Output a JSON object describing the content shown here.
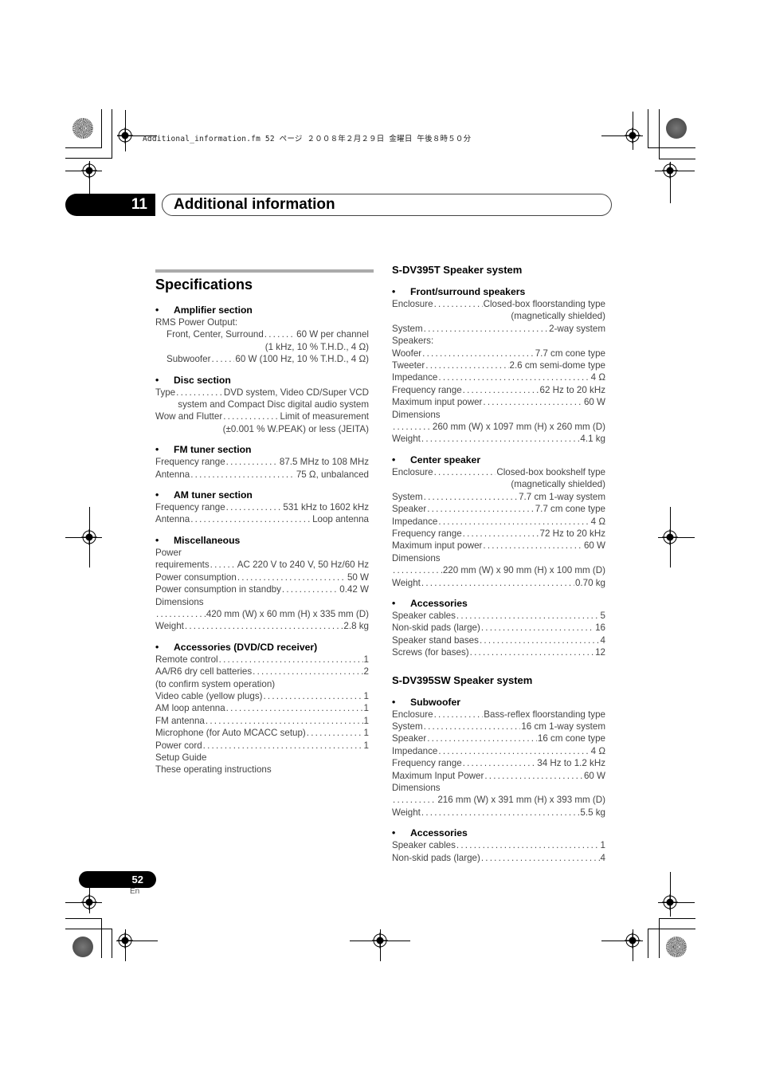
{
  "file_header": "Additional_information.fm  52 ページ  ２００８年２月２９日  金曜日  午後８時５０分",
  "chapter": {
    "number": "11",
    "title": "Additional information"
  },
  "page_title": "Specifications",
  "left_sections": [
    {
      "heading": "Amplifier section",
      "lines": [
        {
          "type": "plain",
          "text": "RMS Power Output:"
        },
        {
          "type": "row",
          "indent": true,
          "label": "Front, Center, Surround",
          "value": "60 W per channel"
        },
        {
          "type": "right",
          "text": "(1 kHz, 10 % T.H.D., 4 Ω)"
        },
        {
          "type": "row",
          "indent": true,
          "label": "Subwoofer",
          "value": "60 W (100 Hz, 10 % T.H.D., 4 Ω)"
        }
      ]
    },
    {
      "heading": "Disc section",
      "lines": [
        {
          "type": "row",
          "label": "Type",
          "value": "DVD system, Video CD/Super VCD"
        },
        {
          "type": "right",
          "text": "system and Compact Disc digital audio system"
        },
        {
          "type": "row",
          "label": "Wow and Flutter",
          "value": "Limit of measurement"
        },
        {
          "type": "right",
          "text": "(±0.001 % W.PEAK) or less (JEITA)"
        }
      ]
    },
    {
      "heading": "FM tuner section",
      "lines": [
        {
          "type": "row",
          "label": "Frequency range",
          "value": "87.5 MHz to 108 MHz"
        },
        {
          "type": "row",
          "label": "Antenna",
          "value": "75 Ω, unbalanced"
        }
      ]
    },
    {
      "heading": "AM tuner section",
      "lines": [
        {
          "type": "row",
          "label": "Frequency range",
          "value": "531 kHz to 1602 kHz"
        },
        {
          "type": "row",
          "label": "Antenna",
          "value": "Loop antenna"
        }
      ]
    },
    {
      "heading": "Miscellaneous",
      "lines": [
        {
          "type": "plain",
          "text": "Power"
        },
        {
          "type": "row",
          "label": "requirements",
          "value": "AC 220 V to 240 V, 50 Hz/60 Hz"
        },
        {
          "type": "row",
          "label": "Power consumption",
          "value": "50 W"
        },
        {
          "type": "row",
          "label": "Power consumption in standby",
          "value": "0.42 W"
        },
        {
          "type": "plain",
          "text": "Dimensions"
        },
        {
          "type": "row",
          "label": "",
          "value": "420 mm (W) x 60 mm (H) x 335 mm (D)"
        },
        {
          "type": "row",
          "label": "Weight",
          "value": "2.8 kg"
        }
      ]
    },
    {
      "heading": "Accessories (DVD/CD receiver)",
      "lines": [
        {
          "type": "row",
          "label": "Remote control",
          "value": "1"
        },
        {
          "type": "row",
          "label": "AA/R6 dry cell batteries",
          "value": "2"
        },
        {
          "type": "plain",
          "text": "(to confirm system operation)"
        },
        {
          "type": "row",
          "label": "Video cable (yellow plugs)",
          "value": "1"
        },
        {
          "type": "row",
          "label": "AM loop antenna",
          "value": "1"
        },
        {
          "type": "row",
          "label": "FM antenna",
          "value": "1"
        },
        {
          "type": "row",
          "label": "Microphone (for Auto MCACC setup)",
          "value": "1"
        },
        {
          "type": "row",
          "label": "Power cord",
          "value": "1"
        },
        {
          "type": "plain",
          "text": "Setup Guide"
        },
        {
          "type": "plain",
          "text": "These operating instructions"
        }
      ]
    }
  ],
  "right_systems": [
    {
      "title": "S-DV395T Speaker system",
      "sections": [
        {
          "heading": "Front/surround speakers",
          "lines": [
            {
              "type": "row",
              "label": "Enclosure",
              "value": "Closed-box floorstanding type"
            },
            {
              "type": "right",
              "text": "(magnetically shielded)"
            },
            {
              "type": "row",
              "label": "System",
              "value": "2-way system"
            },
            {
              "type": "plain",
              "text": "Speakers:"
            },
            {
              "type": "row",
              "label": "Woofer",
              "value": "7.7 cm cone type"
            },
            {
              "type": "row",
              "label": "Tweeter",
              "value": "2.6 cm semi-dome type"
            },
            {
              "type": "row",
              "label": "Impedance",
              "value": "4 Ω"
            },
            {
              "type": "row",
              "label": "Frequency range",
              "value": "62 Hz to 20 kHz"
            },
            {
              "type": "row",
              "label": "Maximum input power",
              "value": "60 W"
            },
            {
              "type": "plain",
              "text": "Dimensions"
            },
            {
              "type": "row",
              "label": "",
              "value": "260 mm (W) x 1097 mm (H) x 260 mm (D)"
            },
            {
              "type": "row",
              "label": "Weight",
              "value": "4.1 kg"
            }
          ]
        },
        {
          "heading": "Center speaker",
          "lines": [
            {
              "type": "row",
              "label": "Enclosure",
              "value": "Closed-box bookshelf type"
            },
            {
              "type": "right",
              "text": "(magnetically shielded)"
            },
            {
              "type": "row",
              "label": "System",
              "value": "7.7 cm 1-way system"
            },
            {
              "type": "row",
              "label": "Speaker",
              "value": "7.7 cm cone type"
            },
            {
              "type": "row",
              "label": "Impedance",
              "value": "4 Ω"
            },
            {
              "type": "row",
              "label": "Frequency range",
              "value": "72 Hz to 20 kHz"
            },
            {
              "type": "row",
              "label": "Maximum input power",
              "value": "60 W"
            },
            {
              "type": "plain",
              "text": "Dimensions"
            },
            {
              "type": "row",
              "label": "",
              "value": "220 mm (W) x 90 mm (H) x 100 mm (D)"
            },
            {
              "type": "row",
              "label": "Weight",
              "value": "0.70 kg"
            }
          ]
        },
        {
          "heading": "Accessories",
          "lines": [
            {
              "type": "row",
              "label": "Speaker cables",
              "value": "5"
            },
            {
              "type": "row",
              "label": "Non-skid pads (large)",
              "value": "16"
            },
            {
              "type": "row",
              "label": "Speaker stand bases",
              "value": "4"
            },
            {
              "type": "row",
              "label": "Screws (for bases)",
              "value": "12"
            }
          ]
        }
      ]
    },
    {
      "title": "S-DV395SW Speaker system",
      "sections": [
        {
          "heading": "Subwoofer",
          "lines": [
            {
              "type": "row",
              "label": "Enclosure",
              "value": "Bass-reflex floorstanding type"
            },
            {
              "type": "row",
              "label": "System",
              "value": "16 cm 1-way system"
            },
            {
              "type": "row",
              "label": "Speaker",
              "value": "16 cm cone type"
            },
            {
              "type": "row",
              "label": "Impedance",
              "value": "4 Ω"
            },
            {
              "type": "row",
              "label": "Frequency range",
              "value": "34 Hz to 1.2 kHz"
            },
            {
              "type": "row",
              "label": "Maximum Input Power",
              "value": "60 W"
            },
            {
              "type": "plain",
              "text": "Dimensions"
            },
            {
              "type": "row",
              "label": "",
              "value": "216 mm (W) x 391 mm (H) x 393 mm (D)"
            },
            {
              "type": "row",
              "label": "Weight",
              "value": "5.5 kg"
            }
          ]
        },
        {
          "heading": "Accessories",
          "lines": [
            {
              "type": "row",
              "label": "Speaker cables",
              "value": "1"
            },
            {
              "type": "row",
              "label": "Non-skid pads (large)",
              "value": "4"
            }
          ]
        }
      ]
    }
  ],
  "footer": {
    "page_number": "52",
    "language": "En"
  }
}
